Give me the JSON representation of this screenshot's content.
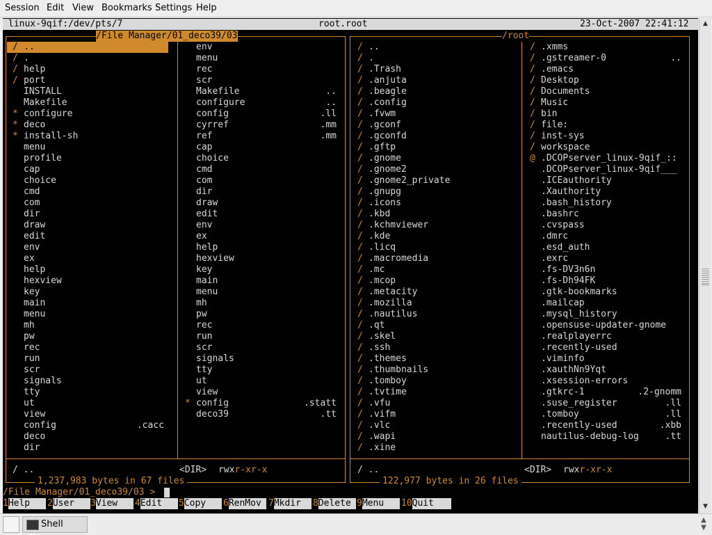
{
  "menubar": [
    "Session",
    "Edit",
    "View",
    "Bookmarks",
    "Settings",
    "Help"
  ],
  "terminal": {
    "tty": "linux-9qif:/dev/pts/7",
    "user": "root.root",
    "datetime": "23-Oct-2007 22:41:12",
    "left_panel": {
      "title": "/File Manager/01_deco39/03",
      "col1": [
        {
          "m": "/",
          "n": "..",
          "e": ""
        },
        {
          "m": "/",
          "n": ".",
          "e": ""
        },
        {
          "m": "/",
          "n": "help",
          "e": ""
        },
        {
          "m": "/",
          "n": "port",
          "e": ""
        },
        {
          "m": "",
          "n": "INSTALL",
          "e": ""
        },
        {
          "m": "",
          "n": "Makefile",
          "e": ""
        },
        {
          "m": "*",
          "n": "configure",
          "e": ""
        },
        {
          "m": "*",
          "n": "deco",
          "e": ""
        },
        {
          "m": "*",
          "n": "install-sh",
          "e": ""
        },
        {
          "m": "",
          "n": "menu",
          "e": ""
        },
        {
          "m": "",
          "n": "profile",
          "e": ""
        },
        {
          "m": "",
          "n": "cap",
          "e": ""
        },
        {
          "m": "",
          "n": "choice",
          "e": ""
        },
        {
          "m": "",
          "n": "cmd",
          "e": ""
        },
        {
          "m": "",
          "n": "com",
          "e": ""
        },
        {
          "m": "",
          "n": "dir",
          "e": ""
        },
        {
          "m": "",
          "n": "draw",
          "e": ""
        },
        {
          "m": "",
          "n": "edit",
          "e": ""
        },
        {
          "m": "",
          "n": "env",
          "e": ""
        },
        {
          "m": "",
          "n": "ex",
          "e": ""
        },
        {
          "m": "",
          "n": "help",
          "e": ""
        },
        {
          "m": "",
          "n": "hexview",
          "e": ""
        },
        {
          "m": "",
          "n": "key",
          "e": ""
        },
        {
          "m": "",
          "n": "main",
          "e": ""
        },
        {
          "m": "",
          "n": "menu",
          "e": ""
        },
        {
          "m": "",
          "n": "mh",
          "e": ""
        },
        {
          "m": "",
          "n": "pw",
          "e": ""
        },
        {
          "m": "",
          "n": "rec",
          "e": ""
        },
        {
          "m": "",
          "n": "run",
          "e": ""
        },
        {
          "m": "",
          "n": "scr",
          "e": ""
        },
        {
          "m": "",
          "n": "signals",
          "e": ""
        },
        {
          "m": "",
          "n": "tty",
          "e": ""
        },
        {
          "m": "",
          "n": "ut",
          "e": ""
        },
        {
          "m": "",
          "n": "view",
          "e": ""
        },
        {
          "m": "",
          "n": "config",
          "e": ".cacc"
        },
        {
          "m": "",
          "n": "deco",
          "e": ""
        },
        {
          "m": "",
          "n": "dir",
          "e": ""
        }
      ],
      "col2": [
        {
          "m": "",
          "n": "env",
          "e": ""
        },
        {
          "m": "",
          "n": "menu",
          "e": ""
        },
        {
          "m": "",
          "n": "rec",
          "e": ""
        },
        {
          "m": "",
          "n": "scr",
          "e": ""
        },
        {
          "m": "",
          "n": "Makefile",
          "e": ".."
        },
        {
          "m": "",
          "n": "configure",
          "e": ".."
        },
        {
          "m": "",
          "n": "config",
          "e": ".ll"
        },
        {
          "m": "",
          "n": "cyrref",
          "e": ".mm"
        },
        {
          "m": "",
          "n": "ref",
          "e": ".mm"
        },
        {
          "m": "",
          "n": "cap",
          "e": ""
        },
        {
          "m": "",
          "n": "choice",
          "e": ""
        },
        {
          "m": "",
          "n": "cmd",
          "e": ""
        },
        {
          "m": "",
          "n": "com",
          "e": ""
        },
        {
          "m": "",
          "n": "dir",
          "e": ""
        },
        {
          "m": "",
          "n": "draw",
          "e": ""
        },
        {
          "m": "",
          "n": "edit",
          "e": ""
        },
        {
          "m": "",
          "n": "env",
          "e": ""
        },
        {
          "m": "",
          "n": "ex",
          "e": ""
        },
        {
          "m": "",
          "n": "help",
          "e": ""
        },
        {
          "m": "",
          "n": "hexview",
          "e": ""
        },
        {
          "m": "",
          "n": "key",
          "e": ""
        },
        {
          "m": "",
          "n": "main",
          "e": ""
        },
        {
          "m": "",
          "n": "menu",
          "e": ""
        },
        {
          "m": "",
          "n": "mh",
          "e": ""
        },
        {
          "m": "",
          "n": "pw",
          "e": ""
        },
        {
          "m": "",
          "n": "rec",
          "e": ""
        },
        {
          "m": "",
          "n": "run",
          "e": ""
        },
        {
          "m": "",
          "n": "scr",
          "e": ""
        },
        {
          "m": "",
          "n": "signals",
          "e": ""
        },
        {
          "m": "",
          "n": "tty",
          "e": ""
        },
        {
          "m": "",
          "n": "ut",
          "e": ""
        },
        {
          "m": "",
          "n": "view",
          "e": ""
        },
        {
          "m": "*",
          "n": "config",
          "e": ".statt"
        },
        {
          "m": "",
          "n": "deco39",
          "e": ".tt"
        }
      ],
      "status_name": "/ ..",
      "status_type": "<DIR>",
      "status_perm_a": "rwx",
      "status_perm_b": "r-xr-x",
      "summary": "1,237,983 bytes in 67 files"
    },
    "right_panel": {
      "title": "/root",
      "col1": [
        {
          "m": "/",
          "n": "..",
          "e": ""
        },
        {
          "m": "/",
          "n": ".",
          "e": ""
        },
        {
          "m": "/",
          "n": ".Trash",
          "e": ""
        },
        {
          "m": "/",
          "n": ".anjuta",
          "e": ""
        },
        {
          "m": "/",
          "n": ".beagle",
          "e": ""
        },
        {
          "m": "/",
          "n": ".config",
          "e": ""
        },
        {
          "m": "/",
          "n": ".fvwm",
          "e": ""
        },
        {
          "m": "/",
          "n": ".gconf",
          "e": ""
        },
        {
          "m": "/",
          "n": ".gconfd",
          "e": ""
        },
        {
          "m": "/",
          "n": ".gftp",
          "e": ""
        },
        {
          "m": "/",
          "n": ".gnome",
          "e": ""
        },
        {
          "m": "/",
          "n": ".gnome2",
          "e": ""
        },
        {
          "m": "/",
          "n": ".gnome2_private",
          "e": ""
        },
        {
          "m": "/",
          "n": ".gnupg",
          "e": ""
        },
        {
          "m": "/",
          "n": ".icons",
          "e": ""
        },
        {
          "m": "/",
          "n": ".kbd",
          "e": ""
        },
        {
          "m": "/",
          "n": ".kchmviewer",
          "e": ""
        },
        {
          "m": "/",
          "n": ".kde",
          "e": ""
        },
        {
          "m": "/",
          "n": ".licq",
          "e": ""
        },
        {
          "m": "/",
          "n": ".macromedia",
          "e": ""
        },
        {
          "m": "/",
          "n": ".mc",
          "e": ""
        },
        {
          "m": "/",
          "n": ".mcop",
          "e": ""
        },
        {
          "m": "/",
          "n": ".metacity",
          "e": ""
        },
        {
          "m": "/",
          "n": ".mozilla",
          "e": ""
        },
        {
          "m": "/",
          "n": ".nautilus",
          "e": ""
        },
        {
          "m": "/",
          "n": ".qt",
          "e": ""
        },
        {
          "m": "/",
          "n": ".skel",
          "e": ""
        },
        {
          "m": "/",
          "n": ".ssh",
          "e": ""
        },
        {
          "m": "/",
          "n": ".themes",
          "e": ""
        },
        {
          "m": "/",
          "n": ".thumbnails",
          "e": ""
        },
        {
          "m": "/",
          "n": ".tomboy",
          "e": ""
        },
        {
          "m": "/",
          "n": ".tvtime",
          "e": ""
        },
        {
          "m": "/",
          "n": ".vfu",
          "e": ""
        },
        {
          "m": "/",
          "n": ".vifm",
          "e": ""
        },
        {
          "m": "/",
          "n": ".vlc",
          "e": ""
        },
        {
          "m": "/",
          "n": ".wapi",
          "e": ""
        },
        {
          "m": "/",
          "n": ".xine",
          "e": ""
        }
      ],
      "col2": [
        {
          "m": "/",
          "n": ".xmms",
          "e": ""
        },
        {
          "m": "/",
          "n": ".gstreamer-0",
          "e": ".."
        },
        {
          "m": "/",
          "n": ".emacs",
          "e": ""
        },
        {
          "m": "/",
          "n": "Desktop",
          "e": ""
        },
        {
          "m": "/",
          "n": "Documents",
          "e": ""
        },
        {
          "m": "/",
          "n": "Music",
          "e": ""
        },
        {
          "m": "/",
          "n": "bin",
          "e": ""
        },
        {
          "m": "/",
          "n": "file:",
          "e": ""
        },
        {
          "m": "/",
          "n": "inst-sys",
          "e": ""
        },
        {
          "m": "/",
          "n": "workspace",
          "e": ""
        },
        {
          "m": "@",
          "n": ".DCOPserver_linux-9qif_::",
          "e": ""
        },
        {
          "m": "",
          "n": ".DCOPserver_linux-9qif___",
          "e": ""
        },
        {
          "m": "",
          "n": ".ICEauthority",
          "e": ""
        },
        {
          "m": "",
          "n": ".Xauthority",
          "e": ""
        },
        {
          "m": "",
          "n": ".bash_history",
          "e": ""
        },
        {
          "m": "",
          "n": ".bashrc",
          "e": ""
        },
        {
          "m": "",
          "n": ".cvspass",
          "e": ""
        },
        {
          "m": "",
          "n": ".dmrc",
          "e": ""
        },
        {
          "m": "",
          "n": ".esd_auth",
          "e": ""
        },
        {
          "m": "",
          "n": ".exrc",
          "e": ""
        },
        {
          "m": "",
          "n": ".fs-DV3n6n",
          "e": ""
        },
        {
          "m": "",
          "n": ".fs-Dh94FK",
          "e": ""
        },
        {
          "m": "",
          "n": ".gtk-bookmarks",
          "e": ""
        },
        {
          "m": "",
          "n": ".mailcap",
          "e": ""
        },
        {
          "m": "",
          "n": ".mysql_history",
          "e": ""
        },
        {
          "m": "",
          "n": ".opensuse-updater-gnome",
          "e": ""
        },
        {
          "m": "",
          "n": ".realplayerrc",
          "e": ""
        },
        {
          "m": "",
          "n": ".recently-used",
          "e": ""
        },
        {
          "m": "",
          "n": ".viminfo",
          "e": ""
        },
        {
          "m": "",
          "n": ".xauthNn9Yqt",
          "e": ""
        },
        {
          "m": "",
          "n": ".xsession-errors",
          "e": ""
        },
        {
          "m": "",
          "n": ".gtkrc-1",
          "e": ".2-gnomm"
        },
        {
          "m": "",
          "n": ".suse_register",
          "e": ".ll"
        },
        {
          "m": "",
          "n": ".tomboy",
          "e": ".ll"
        },
        {
          "m": "",
          "n": ".recently-used",
          "e": ".xbb"
        },
        {
          "m": "",
          "n": "nautilus-debug-log",
          "e": ".tt"
        }
      ],
      "status_name": "/ ..",
      "status_type": "<DIR>",
      "status_perm_a": "rwx",
      "status_perm_b": "r-xr-x",
      "summary": "122,977 bytes in 26 files"
    },
    "prompt": "/File Manager/01_deco39/03 >",
    "fkeys": [
      {
        "n": "1",
        "l": "Help"
      },
      {
        "n": "2",
        "l": "User"
      },
      {
        "n": "3",
        "l": "View"
      },
      {
        "n": "4",
        "l": "Edit"
      },
      {
        "n": "5",
        "l": "Copy"
      },
      {
        "n": "6",
        "l": "RenMov"
      },
      {
        "n": "7",
        "l": "Mkdir"
      },
      {
        "n": "8",
        "l": "Delete"
      },
      {
        "n": "9",
        "l": "Menu"
      },
      {
        "n": "10",
        "l": "Quit"
      }
    ]
  },
  "taskbar": {
    "task_label": "Shell"
  },
  "colors": {
    "accent": "#d18a2b",
    "fg": "#d9d9d9",
    "bg": "#000000",
    "bar": "#d9d9d9"
  }
}
